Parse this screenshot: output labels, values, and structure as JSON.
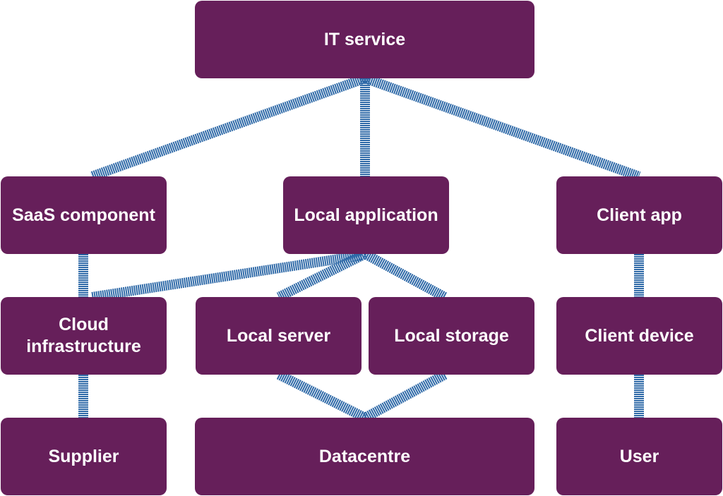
{
  "diagram": {
    "colors": {
      "node_fill": "#661f5a",
      "node_text": "#ffffff",
      "edge": "#2f6aa8"
    },
    "nodes": [
      {
        "id": "it-service",
        "label": "IT service"
      },
      {
        "id": "saas-component",
        "label": "SaaS component"
      },
      {
        "id": "local-application",
        "label": "Local application"
      },
      {
        "id": "client-app",
        "label": "Client app"
      },
      {
        "id": "cloud-infrastructure",
        "label": "Cloud\ninfrastructure"
      },
      {
        "id": "local-server",
        "label": "Local server"
      },
      {
        "id": "local-storage",
        "label": "Local storage"
      },
      {
        "id": "client-device",
        "label": "Client device"
      },
      {
        "id": "supplier",
        "label": "Supplier"
      },
      {
        "id": "datacentre",
        "label": "Datacentre"
      },
      {
        "id": "user",
        "label": "User"
      }
    ],
    "edges": [
      {
        "from": "it-service",
        "to": "saas-component"
      },
      {
        "from": "it-service",
        "to": "local-application"
      },
      {
        "from": "it-service",
        "to": "client-app"
      },
      {
        "from": "saas-component",
        "to": "cloud-infrastructure"
      },
      {
        "from": "local-application",
        "to": "cloud-infrastructure"
      },
      {
        "from": "local-application",
        "to": "local-server"
      },
      {
        "from": "local-application",
        "to": "local-storage"
      },
      {
        "from": "client-app",
        "to": "client-device"
      },
      {
        "from": "cloud-infrastructure",
        "to": "supplier"
      },
      {
        "from": "local-server",
        "to": "datacentre"
      },
      {
        "from": "local-storage",
        "to": "datacentre"
      },
      {
        "from": "client-device",
        "to": "user"
      }
    ]
  }
}
